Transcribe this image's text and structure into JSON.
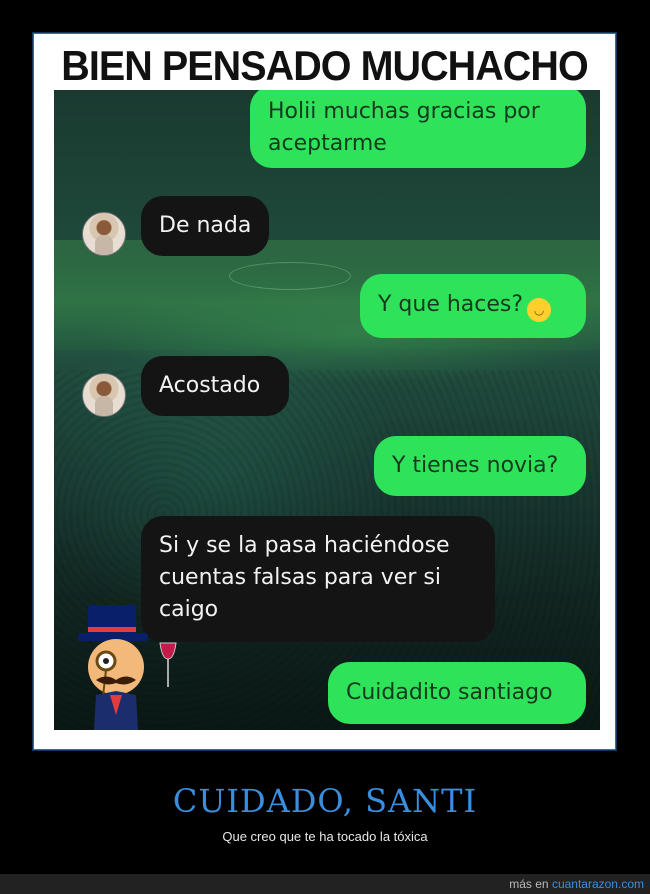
{
  "meme": {
    "title": "BIEN PENSADO MUCHACHO"
  },
  "chat": {
    "messages": [
      {
        "from": "me",
        "text_line1": "Holii muchas gracias por",
        "text_line2": "aceptarme"
      },
      {
        "from": "contact",
        "text": "De nada"
      },
      {
        "from": "me",
        "text": "Y que haces?",
        "emoji": "smirking-face"
      },
      {
        "from": "contact",
        "text": "Acostado"
      },
      {
        "from": "me",
        "text": "Y tienes novia?"
      },
      {
        "from": "contact",
        "text_line1": "Si y se la pasa haciéndose",
        "text_line2": "cuentas falsas para ver si",
        "text_line3": "caigo"
      },
      {
        "from": "me",
        "text": "Cuidadito santiago"
      }
    ],
    "colors": {
      "sent_bubble": "#2ee35a",
      "received_bubble": "#141414",
      "background": "#1f4a3b"
    }
  },
  "caption": {
    "title": "CUIDADO, SANTI",
    "subtitle": "Que creo que te ha tocado la tóxica"
  },
  "footer": {
    "prefix": "más en",
    "link": "cuantarazon.com"
  },
  "colors": {
    "page_background": "#000000",
    "accent": "#3a8ee0"
  }
}
